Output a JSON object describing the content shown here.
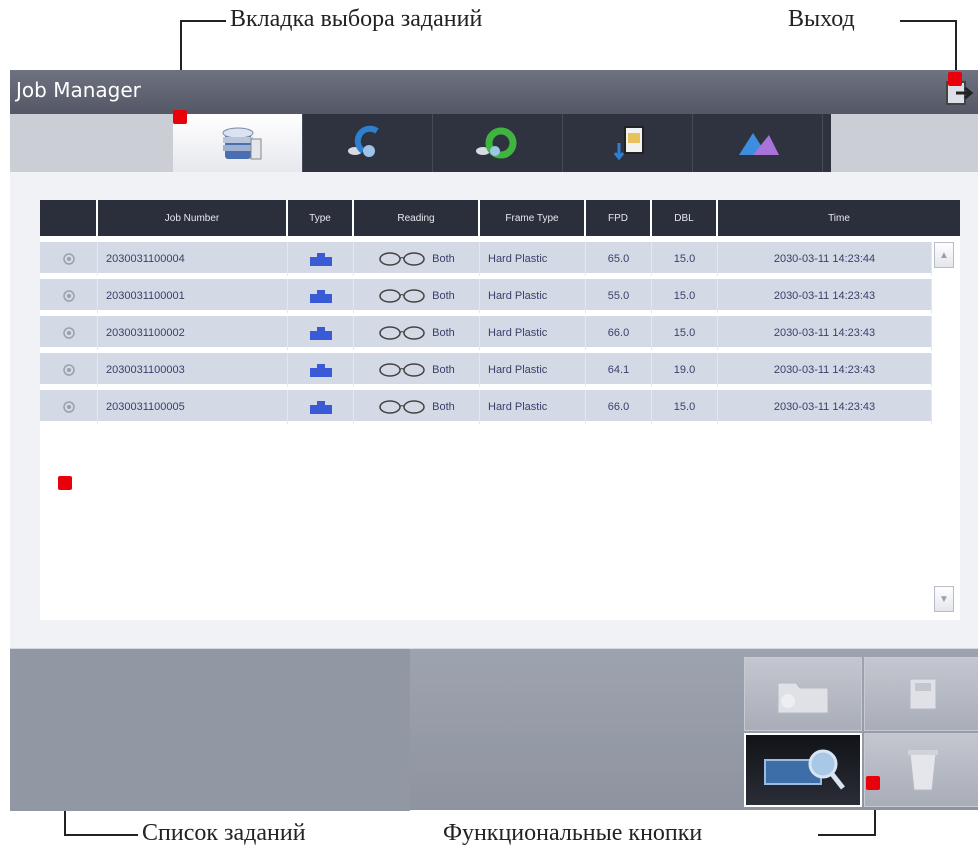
{
  "callouts": {
    "job_tab": "Вкладка выбора заданий",
    "exit": "Выход",
    "job_list": "Список заданий",
    "function_buttons": "Функциональные кнопки"
  },
  "window": {
    "title": "Job Manager"
  },
  "tabs": [
    {
      "icon": "job-database-icon",
      "active": true
    },
    {
      "icon": "lens-scan-icon",
      "active": false
    },
    {
      "icon": "lens-rotate-icon",
      "active": false
    },
    {
      "icon": "sd-card-transfer-icon",
      "active": false
    },
    {
      "icon": "image-editor-icon",
      "active": false
    }
  ],
  "table": {
    "columns": [
      "",
      "Job Number",
      "Type",
      "Reading",
      "Frame Type",
      "FPD",
      "DBL",
      "Time"
    ],
    "rows": [
      {
        "job_number": "2030031100004",
        "reading": "Both",
        "frame_type": "Hard Plastic",
        "fpd": "65.0",
        "dbl": "15.0",
        "time": "2030-03-11  14:23:44"
      },
      {
        "job_number": "2030031100001",
        "reading": "Both",
        "frame_type": "Hard Plastic",
        "fpd": "55.0",
        "dbl": "15.0",
        "time": "2030-03-11  14:23:43"
      },
      {
        "job_number": "2030031100002",
        "reading": "Both",
        "frame_type": "Hard Plastic",
        "fpd": "66.0",
        "dbl": "15.0",
        "time": "2030-03-11  14:23:43"
      },
      {
        "job_number": "2030031100003",
        "reading": "Both",
        "frame_type": "Hard Plastic",
        "fpd": "64.1",
        "dbl": "19.0",
        "time": "2030-03-11  14:23:43"
      },
      {
        "job_number": "2030031100005",
        "reading": "Both",
        "frame_type": "Hard Plastic",
        "fpd": "66.0",
        "dbl": "15.0",
        "time": "2030-03-11  14:23:43"
      }
    ]
  },
  "colors": {
    "marker": "#e8000b",
    "header": "#2b2f3b",
    "row": "#d4d9e6",
    "type_icon": "#3b5bd6"
  },
  "function_buttons": [
    {
      "icon": "open-folder-icon",
      "active": false
    },
    {
      "icon": "save-icon",
      "active": false
    },
    {
      "icon": "search-job-icon",
      "active": true
    },
    {
      "icon": "trash-icon",
      "active": false
    }
  ]
}
